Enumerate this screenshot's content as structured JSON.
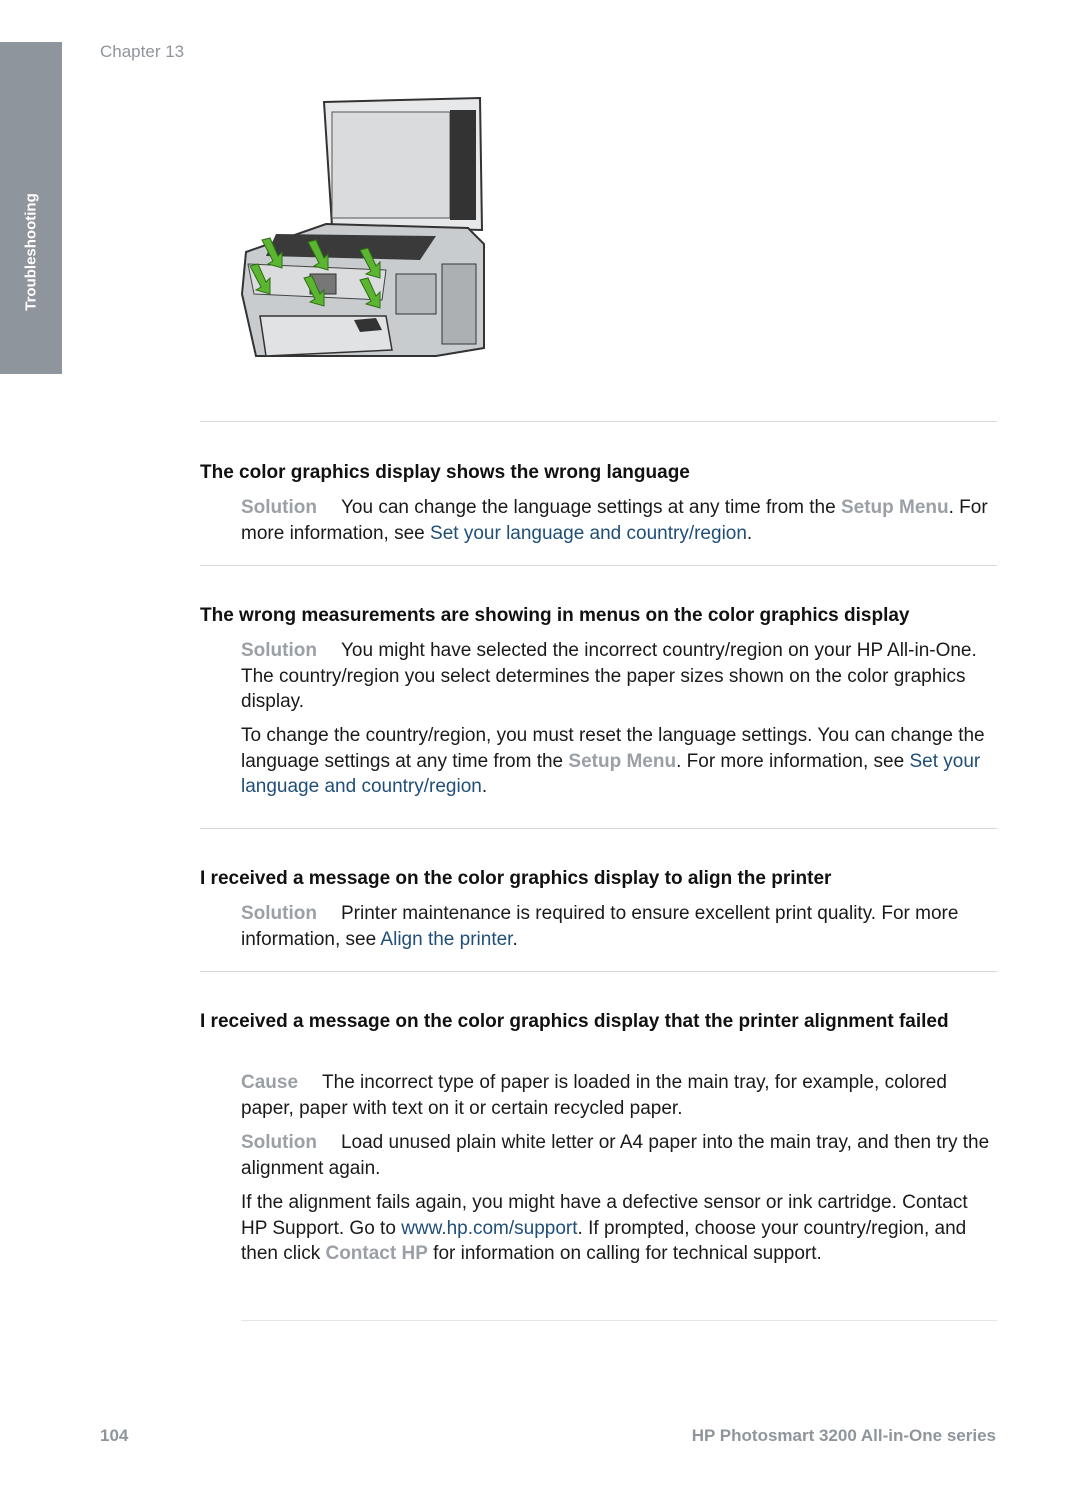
{
  "sidebar": {
    "tab_label": "Troubleshooting"
  },
  "header": {
    "chapter": "Chapter 13"
  },
  "illustration": {
    "alt": "HP All-in-One with lid open, green arrows indicating control panel overlay"
  },
  "sections": [
    {
      "heading": "The color graphics display shows the wrong language",
      "paragraphs": [
        {
          "label": "Solution",
          "t1": "You can change the language settings at any time from the ",
          "ui": "Setup Menu",
          "t2": ". For more information, see ",
          "link": "Set your language and country/region",
          "t3": "."
        }
      ]
    },
    {
      "heading": "The wrong measurements are showing in menus on the color graphics display",
      "paragraphs": [
        {
          "label": "Solution",
          "t1": "You might have selected the incorrect country/region on your HP All-in-One. The country/region you select determines the paper sizes shown on the color graphics display."
        },
        {
          "t1": "To change the country/region, you must reset the language settings. You can change the language settings at any time from the ",
          "ui": "Setup Menu",
          "t2": ". For more information, see ",
          "link": "Set your language and country/region",
          "t3": "."
        }
      ]
    },
    {
      "heading": "I received a message on the color graphics display to align the printer",
      "paragraphs": [
        {
          "label": "Solution",
          "t1": "Printer maintenance is required to ensure excellent print quality. For more information, see ",
          "link": "Align the printer",
          "t2": "."
        }
      ]
    },
    {
      "heading": "I received a message on the color graphics display that the printer alignment failed",
      "paragraphs": [
        {
          "label": "Cause",
          "t1": "The incorrect type of paper is loaded in the main tray, for example, colored paper, paper with text on it or certain recycled paper."
        },
        {
          "label": "Solution",
          "t1": "Load unused plain white letter or A4 paper into the main tray, and then try the alignment again."
        },
        {
          "t1": "If the alignment fails again, you might have a defective sensor or ink cartridge. Contact HP Support. Go to ",
          "link": "www.hp.com/support",
          "t2": ". If prompted, choose your country/region, and then click ",
          "ui": "Contact HP",
          "t3": " for information on calling for technical support."
        }
      ]
    }
  ],
  "footer": {
    "page_number": "104",
    "product_regular": "HP Photosmart 3200 ",
    "product_bold": "All-in-One series"
  }
}
